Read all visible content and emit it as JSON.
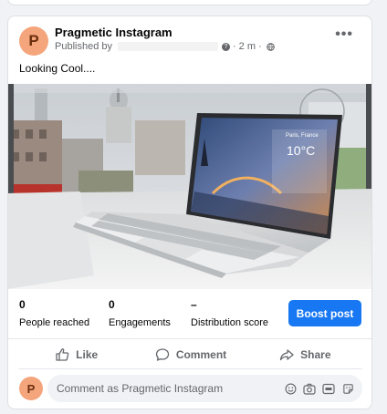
{
  "post": {
    "author_initial": "P",
    "author_name": "Pragmetic Instagram",
    "published_by": "Published by",
    "separator": "·",
    "time": "2 m",
    "caption": "Looking Cool...."
  },
  "photo": {
    "screen_city": "Paris, France",
    "screen_temp": "10°C"
  },
  "stats": {
    "reached_value": "0",
    "reached_label": "People reached",
    "engagements_value": "0",
    "engagements_label": "Engagements",
    "distribution_value": "–",
    "distribution_label": "Distribution score",
    "boost_label": "Boost post"
  },
  "actions": {
    "like": "Like",
    "comment": "Comment",
    "share": "Share"
  },
  "comment_box": {
    "avatar_initial": "P",
    "placeholder": "Comment as Pragmetic Instagram"
  },
  "colors": {
    "accent": "#1877f2",
    "avatar_bg": "#f4a57c",
    "secondary_text": "#65676b"
  }
}
